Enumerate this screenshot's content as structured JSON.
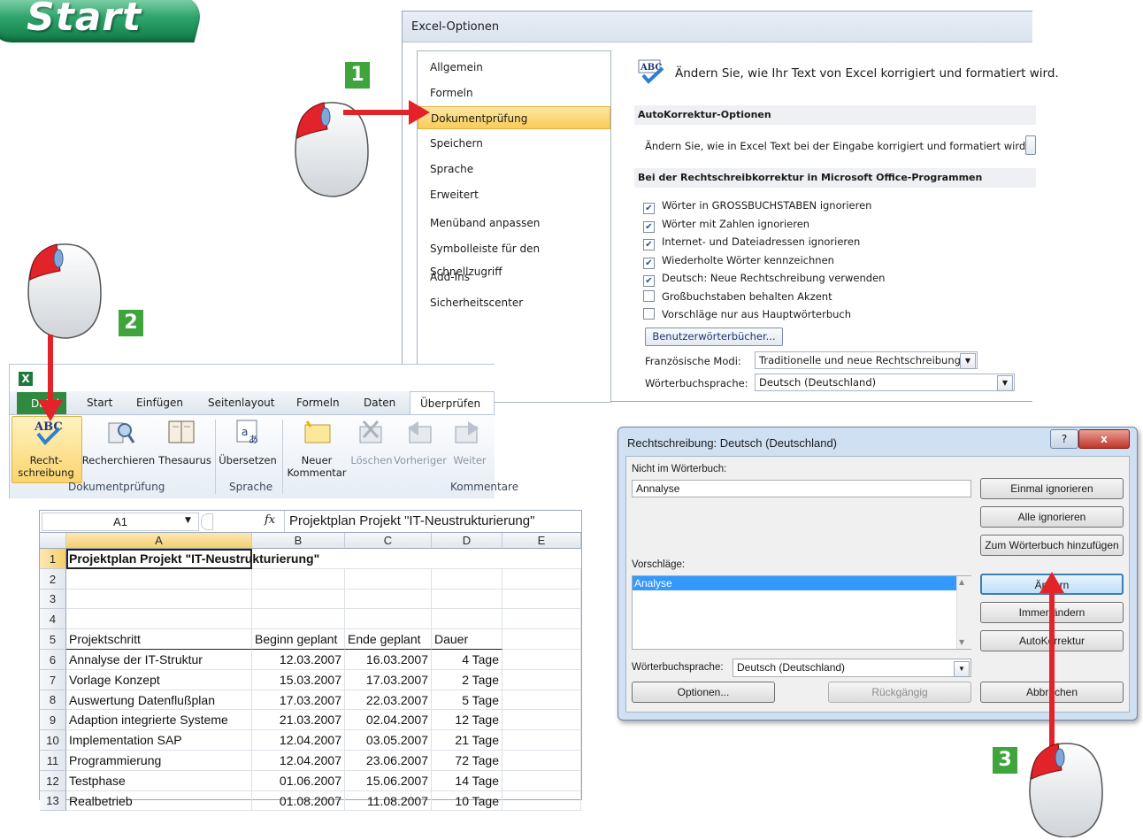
{
  "banner": {
    "label": "Start"
  },
  "steps": [
    "1",
    "2",
    "3"
  ],
  "options_dialog": {
    "title": "Excel-Optionen",
    "nav": [
      "Allgemein",
      "Formeln",
      "Dokumentprüfung",
      "Speichern",
      "Sprache",
      "Erweitert",
      "Menüband anpassen",
      "Symbolleiste für den Schnellzugriff",
      "Add-Ins",
      "Sicherheitscenter"
    ],
    "selected_nav": "Dokumentprüfung",
    "intro": "Ändern Sie, wie Ihr Text von Excel korrigiert und formatiert wird.",
    "autocorrect_heading": "AutoKorrektur-Optionen",
    "autocorrect_text": "Ändern Sie, wie in Excel Text bei der Eingabe korrigiert und formatiert wird.",
    "spelling_heading": "Bei der Rechtschreibkorrektur in Microsoft Office-Programmen",
    "checkboxes": [
      {
        "label": "Wörter in GROSSBUCHSTABEN ignorieren",
        "checked": true
      },
      {
        "label": "Wörter mit Zahlen ignorieren",
        "checked": true
      },
      {
        "label": "Internet- und Dateiadressen ignorieren",
        "checked": true
      },
      {
        "label": "Wiederholte Wörter kennzeichnen",
        "checked": true
      },
      {
        "label": "Deutsch: Neue Rechtschreibung verwenden",
        "checked": true
      },
      {
        "label": "Großbuchstaben behalten Akzent",
        "checked": false
      },
      {
        "label": "Vorschläge nur aus Hauptwörterbuch",
        "checked": false
      }
    ],
    "custom_dict_button": "Benutzerwörterbücher...",
    "french_label": "Französische Modi:",
    "french_value": "Traditionelle und neue Rechtschreibung",
    "dict_lang_label": "Wörterbuchsprache:",
    "dict_lang_value": "Deutsch (Deutschland)"
  },
  "ribbon": {
    "tabs": [
      "Datei",
      "Start",
      "Einfügen",
      "Seitenlayout",
      "Formeln",
      "Daten",
      "Überprüfen"
    ],
    "active_tab": "Überprüfen",
    "buttons": {
      "spelling_line1": "Recht-",
      "spelling_line2": "schreibung",
      "research": "Recherchieren",
      "thesaurus": "Thesaurus",
      "translate": "Übersetzen",
      "new_comment_line1": "Neuer",
      "new_comment_line2": "Kommentar",
      "delete": "Löschen",
      "previous": "Vorheriger",
      "next": "Weiter"
    },
    "groups": [
      "Dokumentprüfung",
      "Sprache",
      "Kommentare"
    ]
  },
  "sheet": {
    "name_box": "A1",
    "fx": "fx",
    "formula": "Projektplan Projekt \"IT-Neustrukturierung\"",
    "columns": [
      "A",
      "B",
      "C",
      "D",
      "E"
    ],
    "title": "Projektplan Projekt \"IT-Neustrukturierung\"",
    "headers": [
      "Projektschritt",
      "Beginn geplant",
      "Ende geplant",
      "Dauer"
    ],
    "rows": [
      [
        "Annalyse der IT-Struktur",
        "12.03.2007",
        "16.03.2007",
        "4 Tage"
      ],
      [
        "Vorlage Konzept",
        "15.03.2007",
        "17.03.2007",
        "2 Tage"
      ],
      [
        "Auswertung Datenflußplan",
        "17.03.2007",
        "22.03.2007",
        "5 Tage"
      ],
      [
        "Adaption integrierte Systeme",
        "21.03.2007",
        "02.04.2007",
        "12 Tage"
      ],
      [
        "Implementation SAP",
        "12.04.2007",
        "03.05.2007",
        "21 Tage"
      ],
      [
        "Programmierung",
        "12.04.2007",
        "23.06.2007",
        "72 Tage"
      ],
      [
        "Testphase",
        "01.06.2007",
        "15.06.2007",
        "14 Tage"
      ],
      [
        "Realbetrieb",
        "01.08.2007",
        "11.08.2007",
        "10 Tage"
      ]
    ],
    "row_numbers": [
      "1",
      "2",
      "3",
      "4",
      "5",
      "6",
      "7",
      "8",
      "9",
      "10",
      "11",
      "12",
      "13"
    ]
  },
  "spell_dialog": {
    "title": "Rechtschreibung: Deutsch (Deutschland)",
    "not_in_dict_label": "Nicht im Wörterbuch:",
    "not_in_dict_value": "Annalyse",
    "suggestions_label": "Vorschläge:",
    "suggestion": "Analyse",
    "buttons": {
      "ignore_once": "Einmal ignorieren",
      "ignore_all": "Alle ignorieren",
      "add_dict": "Zum Wörterbuch hinzufügen",
      "change": "Ändern",
      "change_all": "Immer ändern",
      "autocorrect": "AutoKorrektur",
      "options": "Optionen...",
      "undo": "Rückgängig",
      "cancel": "Abbrechen"
    },
    "lang_label": "Wörterbuchsprache:",
    "lang_value": "Deutsch (Deutschland)",
    "help": "?",
    "close": "x"
  },
  "colors": {
    "accent_red": "#e2232a",
    "badge_green": "#3fa43c",
    "selection_yellow": "#f9cc58"
  }
}
